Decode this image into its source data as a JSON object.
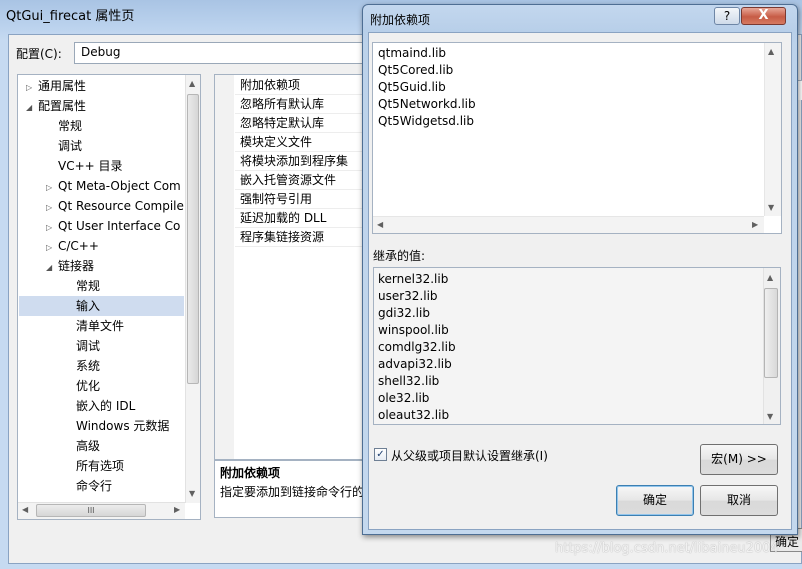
{
  "window": {
    "title": "QtGui_firecat 属性页"
  },
  "config": {
    "label": "配置(C):",
    "value": "Debug"
  },
  "tree": {
    "items": [
      {
        "label": "通用属性",
        "level": 0,
        "arrow": "▷"
      },
      {
        "label": "配置属性",
        "level": 0,
        "arrow": "◢"
      },
      {
        "label": "常规",
        "level": 1,
        "arrow": ""
      },
      {
        "label": "调试",
        "level": 1,
        "arrow": ""
      },
      {
        "label": "VC++ 目录",
        "level": 1,
        "arrow": ""
      },
      {
        "label": "Qt Meta-Object Com",
        "level": 1,
        "arrow": "▷"
      },
      {
        "label": "Qt Resource Compile",
        "level": 1,
        "arrow": "▷"
      },
      {
        "label": "Qt User Interface Co",
        "level": 1,
        "arrow": "▷"
      },
      {
        "label": "C/C++",
        "level": 1,
        "arrow": "▷"
      },
      {
        "label": "链接器",
        "level": 1,
        "arrow": "◢"
      },
      {
        "label": "常规",
        "level": 2,
        "arrow": ""
      },
      {
        "label": "输入",
        "level": 2,
        "arrow": "",
        "selected": true
      },
      {
        "label": "清单文件",
        "level": 2,
        "arrow": ""
      },
      {
        "label": "调试",
        "level": 2,
        "arrow": ""
      },
      {
        "label": "系统",
        "level": 2,
        "arrow": ""
      },
      {
        "label": "优化",
        "level": 2,
        "arrow": ""
      },
      {
        "label": "嵌入的 IDL",
        "level": 2,
        "arrow": ""
      },
      {
        "label": "Windows 元数据",
        "level": 2,
        "arrow": ""
      },
      {
        "label": "高级",
        "level": 2,
        "arrow": ""
      },
      {
        "label": "所有选项",
        "level": 2,
        "arrow": ""
      },
      {
        "label": "命令行",
        "level": 2,
        "arrow": ""
      }
    ],
    "hscroll_grip": "III"
  },
  "grid": {
    "rows": [
      "附加依赖项",
      "忽略所有默认库",
      "忽略特定默认库",
      "模块定义文件",
      "将模块添加到程序集",
      "嵌入托管资源文件",
      "强制符号引用",
      "延迟加载的 DLL",
      "程序集链接资源"
    ]
  },
  "description": {
    "title": "附加依赖项",
    "text": "指定要添加到链接命令行的"
  },
  "background_ok_label": "确定",
  "dialog": {
    "title": "附加依赖项",
    "help_label": "?",
    "close_label": "X",
    "libs": [
      "qtmaind.lib",
      "Qt5Cored.lib",
      "Qt5Guid.lib",
      "Qt5Networkd.lib",
      "Qt5Widgetsd.lib"
    ],
    "inherited_label": "继承的值:",
    "inherited": [
      "kernel32.lib",
      "user32.lib",
      "gdi32.lib",
      "winspool.lib",
      "comdlg32.lib",
      "advapi32.lib",
      "shell32.lib",
      "ole32.lib",
      "oleaut32.lib"
    ],
    "checkbox_label": "从父级或项目默认设置继承(I)",
    "checkbox_checked": true,
    "macro_button": "宏(M) >>",
    "ok_button": "确定",
    "cancel_button": "取消"
  },
  "watermark": "https://blog.csdn.net/libaineu2004"
}
